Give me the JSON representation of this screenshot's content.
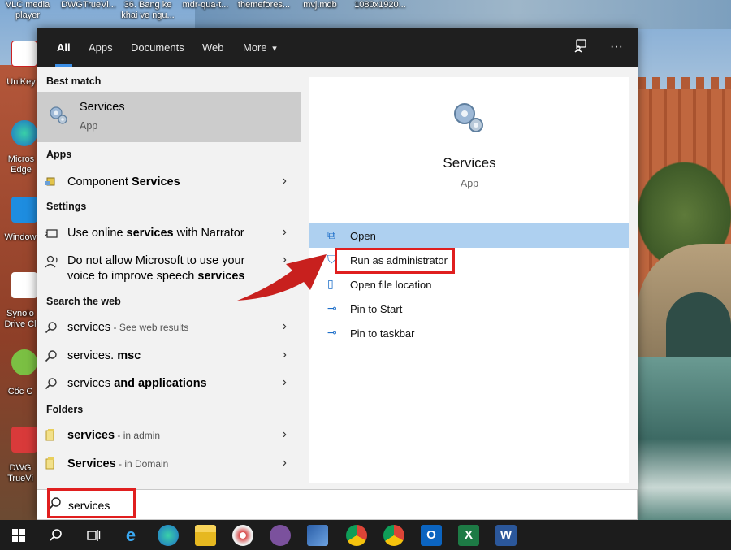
{
  "desktop": {
    "top_labels": [
      {
        "text": "VLC media\nplayer"
      },
      {
        "text": "DWGTrueVi..."
      },
      {
        "text": "36. Bang ke\nkhai ve ngu..."
      },
      {
        "text": "mdr-qua-t..."
      },
      {
        "text": "themefores..."
      },
      {
        "text": "mvj.mdb"
      },
      {
        "text": "1080x1920..."
      }
    ],
    "left_icons": [
      {
        "label": "UniKey"
      },
      {
        "label": "Micros\nEdge"
      },
      {
        "label": "Window"
      },
      {
        "label": "Synolo\nDrive Cl"
      },
      {
        "label": "Cốc C"
      },
      {
        "label": "DWG\nTrueVi"
      }
    ]
  },
  "filter_bar": {
    "tabs": [
      "All",
      "Apps",
      "Documents",
      "Web",
      "More"
    ],
    "active_tab": "All",
    "more_caret": "▾",
    "feedback_icon": "feedback-icon",
    "ellipsis": "···"
  },
  "left_pane": {
    "best_match_header": "Best match",
    "best_match": {
      "title": "Services",
      "subtitle": "App"
    },
    "apps_header": "Apps",
    "apps": [
      {
        "prefix": "Component ",
        "bold": "Services",
        "suffix": ""
      }
    ],
    "settings_header": "Settings",
    "settings": [
      {
        "line1_prefix": "Use online ",
        "line1_bold": "services",
        "line1_suffix": " with Narrator"
      },
      {
        "line1": "Do not allow Microsoft to use your",
        "line2_prefix": "voice to improve speech ",
        "line2_bold": "services"
      }
    ],
    "web_header": "Search the web",
    "web": [
      {
        "bold": "services",
        "hint": " - See web results"
      },
      {
        "normal": "services.",
        "bold": " msc"
      },
      {
        "normal": "services ",
        "bold": "and applications"
      }
    ],
    "folders_header": "Folders",
    "folders": [
      {
        "bold": "services",
        "hint": " - in admin"
      },
      {
        "bold": "Services",
        "hint": " - in Domain"
      }
    ],
    "chevron": "›"
  },
  "right_pane": {
    "app_name": "Services",
    "app_kind": "App",
    "actions": [
      {
        "label": "Open",
        "icon": "open-icon",
        "glyph": "⧉"
      },
      {
        "label": "Run as administrator",
        "icon": "shield-icon",
        "glyph": "⛉"
      },
      {
        "label": "Open file location",
        "icon": "folder-icon",
        "glyph": "▯"
      },
      {
        "label": "Pin to Start",
        "icon": "pin-icon",
        "glyph": "⊸"
      },
      {
        "label": "Pin to taskbar",
        "icon": "pin-taskbar-icon",
        "glyph": "⊸"
      }
    ]
  },
  "search_box": {
    "value": "services"
  },
  "taskbar": {
    "icons": [
      {
        "name": "windows-start-icon"
      },
      {
        "name": "search-icon"
      },
      {
        "name": "task-view-icon"
      },
      {
        "name": "internet-explorer-icon"
      },
      {
        "name": "edge-icon"
      },
      {
        "name": "file-explorer-icon"
      },
      {
        "name": "paint-icon"
      },
      {
        "name": "viber-icon"
      },
      {
        "name": "remote-desktop-icon"
      },
      {
        "name": "chrome-icon"
      },
      {
        "name": "chrome-alt-icon"
      },
      {
        "name": "outlook-icon",
        "letter": "O"
      },
      {
        "name": "excel-icon",
        "letter": "X"
      },
      {
        "name": "word-icon",
        "letter": "W"
      }
    ]
  },
  "colors": {
    "accent": "#3b8ee5",
    "highlight": "#aed0f0",
    "annotation": "#e01f1f",
    "taskbar": "#1c1c1c"
  }
}
